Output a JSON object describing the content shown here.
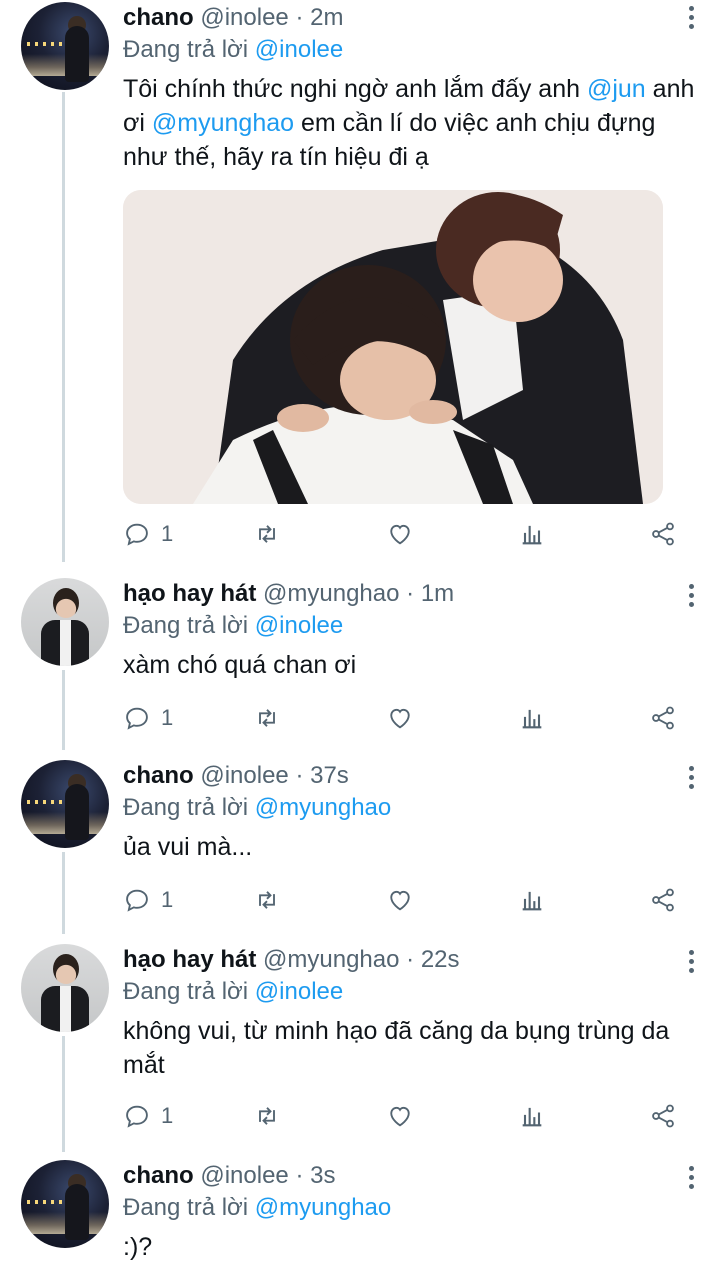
{
  "tweets": [
    {
      "name": "chano",
      "handle": "@inolee",
      "time": "2m",
      "replying_prefix": "Đang trả lời ",
      "replying_to": "@inolee",
      "text_parts": [
        "Tôi chính thức nghi ngờ anh lắm đấy anh ",
        "@jun",
        " anh ơi ",
        "@myunghao",
        " em cần lí do việc anh chịu đựng như thế, hãy ra tín hiệu đi ạ"
      ],
      "reply_count": "1"
    },
    {
      "name": "hạo hay hát",
      "handle": "@myunghao",
      "time": "1m",
      "replying_prefix": "Đang trả lời ",
      "replying_to": "@inolee",
      "text": "xàm chó quá chan ơi",
      "reply_count": "1"
    },
    {
      "name": "chano",
      "handle": "@inolee",
      "time": "37s",
      "replying_prefix": "Đang trả lời ",
      "replying_to": "@myunghao",
      "text": "ủa vui mà...",
      "reply_count": "1"
    },
    {
      "name": "hạo hay hát",
      "handle": "@myunghao",
      "time": "22s",
      "replying_prefix": "Đang trả lời ",
      "replying_to": "@inolee",
      "text": "không vui, từ minh hạo đã căng da bụng trùng da mắt",
      "reply_count": "1"
    },
    {
      "name": "chano",
      "handle": "@inolee",
      "time": "3s",
      "replying_prefix": "Đang trả lời ",
      "replying_to": "@myunghao",
      "text": ":)?"
    }
  ],
  "separator": " · ",
  "icons": {
    "reply": "reply-icon",
    "retweet": "retweet-icon",
    "like": "heart-icon",
    "views": "analytics-icon",
    "share": "share-icon",
    "more": "more-vertical-icon"
  },
  "colors": {
    "link": "#1d9bf0",
    "secondary": "#536471",
    "thread_line": "#cfd9de"
  }
}
